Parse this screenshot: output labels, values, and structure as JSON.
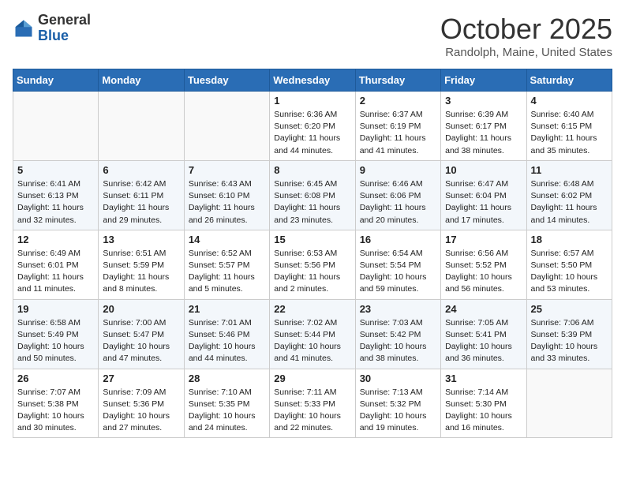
{
  "header": {
    "logo_general": "General",
    "logo_blue": "Blue",
    "month_title": "October 2025",
    "location": "Randolph, Maine, United States"
  },
  "days_of_week": [
    "Sunday",
    "Monday",
    "Tuesday",
    "Wednesday",
    "Thursday",
    "Friday",
    "Saturday"
  ],
  "weeks": [
    [
      {
        "day": "",
        "info": ""
      },
      {
        "day": "",
        "info": ""
      },
      {
        "day": "",
        "info": ""
      },
      {
        "day": "1",
        "info": "Sunrise: 6:36 AM\nSunset: 6:20 PM\nDaylight: 11 hours\nand 44 minutes."
      },
      {
        "day": "2",
        "info": "Sunrise: 6:37 AM\nSunset: 6:19 PM\nDaylight: 11 hours\nand 41 minutes."
      },
      {
        "day": "3",
        "info": "Sunrise: 6:39 AM\nSunset: 6:17 PM\nDaylight: 11 hours\nand 38 minutes."
      },
      {
        "day": "4",
        "info": "Sunrise: 6:40 AM\nSunset: 6:15 PM\nDaylight: 11 hours\nand 35 minutes."
      }
    ],
    [
      {
        "day": "5",
        "info": "Sunrise: 6:41 AM\nSunset: 6:13 PM\nDaylight: 11 hours\nand 32 minutes."
      },
      {
        "day": "6",
        "info": "Sunrise: 6:42 AM\nSunset: 6:11 PM\nDaylight: 11 hours\nand 29 minutes."
      },
      {
        "day": "7",
        "info": "Sunrise: 6:43 AM\nSunset: 6:10 PM\nDaylight: 11 hours\nand 26 minutes."
      },
      {
        "day": "8",
        "info": "Sunrise: 6:45 AM\nSunset: 6:08 PM\nDaylight: 11 hours\nand 23 minutes."
      },
      {
        "day": "9",
        "info": "Sunrise: 6:46 AM\nSunset: 6:06 PM\nDaylight: 11 hours\nand 20 minutes."
      },
      {
        "day": "10",
        "info": "Sunrise: 6:47 AM\nSunset: 6:04 PM\nDaylight: 11 hours\nand 17 minutes."
      },
      {
        "day": "11",
        "info": "Sunrise: 6:48 AM\nSunset: 6:02 PM\nDaylight: 11 hours\nand 14 minutes."
      }
    ],
    [
      {
        "day": "12",
        "info": "Sunrise: 6:49 AM\nSunset: 6:01 PM\nDaylight: 11 hours\nand 11 minutes."
      },
      {
        "day": "13",
        "info": "Sunrise: 6:51 AM\nSunset: 5:59 PM\nDaylight: 11 hours\nand 8 minutes."
      },
      {
        "day": "14",
        "info": "Sunrise: 6:52 AM\nSunset: 5:57 PM\nDaylight: 11 hours\nand 5 minutes."
      },
      {
        "day": "15",
        "info": "Sunrise: 6:53 AM\nSunset: 5:56 PM\nDaylight: 11 hours\nand 2 minutes."
      },
      {
        "day": "16",
        "info": "Sunrise: 6:54 AM\nSunset: 5:54 PM\nDaylight: 10 hours\nand 59 minutes."
      },
      {
        "day": "17",
        "info": "Sunrise: 6:56 AM\nSunset: 5:52 PM\nDaylight: 10 hours\nand 56 minutes."
      },
      {
        "day": "18",
        "info": "Sunrise: 6:57 AM\nSunset: 5:50 PM\nDaylight: 10 hours\nand 53 minutes."
      }
    ],
    [
      {
        "day": "19",
        "info": "Sunrise: 6:58 AM\nSunset: 5:49 PM\nDaylight: 10 hours\nand 50 minutes."
      },
      {
        "day": "20",
        "info": "Sunrise: 7:00 AM\nSunset: 5:47 PM\nDaylight: 10 hours\nand 47 minutes."
      },
      {
        "day": "21",
        "info": "Sunrise: 7:01 AM\nSunset: 5:46 PM\nDaylight: 10 hours\nand 44 minutes."
      },
      {
        "day": "22",
        "info": "Sunrise: 7:02 AM\nSunset: 5:44 PM\nDaylight: 10 hours\nand 41 minutes."
      },
      {
        "day": "23",
        "info": "Sunrise: 7:03 AM\nSunset: 5:42 PM\nDaylight: 10 hours\nand 38 minutes."
      },
      {
        "day": "24",
        "info": "Sunrise: 7:05 AM\nSunset: 5:41 PM\nDaylight: 10 hours\nand 36 minutes."
      },
      {
        "day": "25",
        "info": "Sunrise: 7:06 AM\nSunset: 5:39 PM\nDaylight: 10 hours\nand 33 minutes."
      }
    ],
    [
      {
        "day": "26",
        "info": "Sunrise: 7:07 AM\nSunset: 5:38 PM\nDaylight: 10 hours\nand 30 minutes."
      },
      {
        "day": "27",
        "info": "Sunrise: 7:09 AM\nSunset: 5:36 PM\nDaylight: 10 hours\nand 27 minutes."
      },
      {
        "day": "28",
        "info": "Sunrise: 7:10 AM\nSunset: 5:35 PM\nDaylight: 10 hours\nand 24 minutes."
      },
      {
        "day": "29",
        "info": "Sunrise: 7:11 AM\nSunset: 5:33 PM\nDaylight: 10 hours\nand 22 minutes."
      },
      {
        "day": "30",
        "info": "Sunrise: 7:13 AM\nSunset: 5:32 PM\nDaylight: 10 hours\nand 19 minutes."
      },
      {
        "day": "31",
        "info": "Sunrise: 7:14 AM\nSunset: 5:30 PM\nDaylight: 10 hours\nand 16 minutes."
      },
      {
        "day": "",
        "info": ""
      }
    ]
  ]
}
